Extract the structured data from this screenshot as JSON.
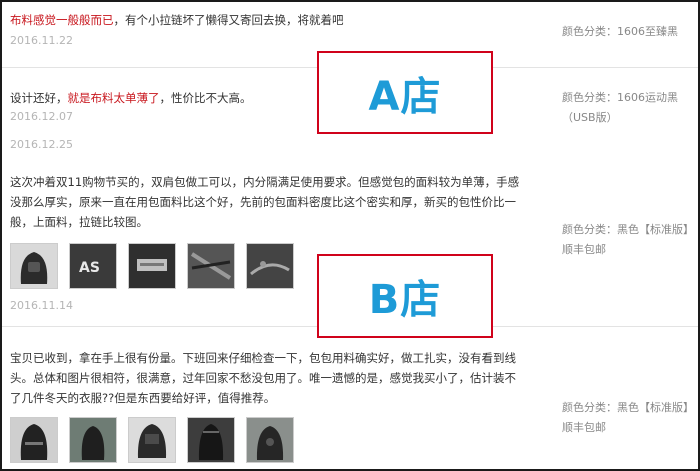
{
  "reviews": [
    {
      "text_highlight": "布料感觉一般般而已",
      "text_rest": "，有个小拉链坏了懒得又寄回去换，将就着吧",
      "date": "2016.11.22",
      "spec_label": "颜色分类：",
      "spec_value": "1606至臻黑"
    },
    {
      "text_before": "设计还好，",
      "text_highlight": "就是布料太单薄了",
      "text_after": "，性价比不大高。",
      "date": "2016.12.07",
      "date_extra": "2016.12.25",
      "spec_label": "颜色分类：",
      "spec_value": "1606运动黑（USB版）"
    },
    {
      "text": "这次冲着双11购物节买的，双肩包做工可以，内分隔满足使用要求。但感觉包的面料较为单薄，手感没那么厚实，原来一直在用包面料比这个好，先前的包面料密度比这个密实和厚，新买的包性价比一般，上面料，拉链比较图。",
      "date": "2016.11.14",
      "spec_label": "颜色分类：",
      "spec_value": "黑色【标准版】顺丰包邮",
      "thumbs": [
        "backpack-photo-1",
        "backpack-logo-photo",
        "backpack-label-photo",
        "backpack-zipper-photo",
        "backpack-zipper-photo-2"
      ]
    },
    {
      "text": "宝贝已收到，拿在手上很有份量。下班回来仔细检查一下，包包用料确实好，做工扎实，没有看到线头。总体和图片很相符，很满意，过年回家不愁没包用了。唯一遗憾的是，感觉我买小了，估计装不了几件冬天的衣服??但是东西要给好评，值得推荐。",
      "spec_label": "颜色分类：",
      "spec_value": "黑色【标准版】顺丰包邮",
      "thumbs": [
        "backpack-front-photo",
        "backpack-side-photo",
        "backpack-open-photo",
        "backpack-back-photo",
        "backpack-dark-photo"
      ]
    }
  ],
  "callouts": {
    "a_label": "A店",
    "b_label": "B店"
  },
  "colors": {
    "highlight": "#c8161d",
    "callout_border": "#d0021b",
    "callout_text": "#1e9bd7"
  }
}
